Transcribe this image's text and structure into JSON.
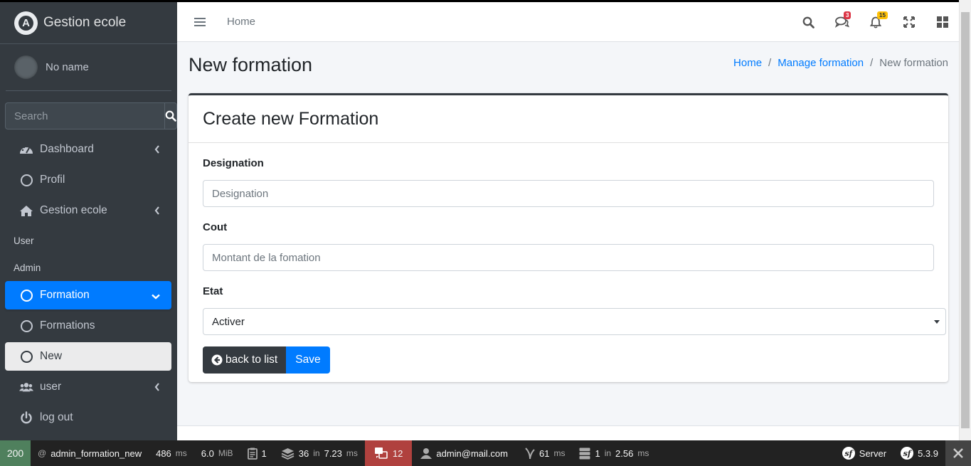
{
  "brand": {
    "name": "Gestion ecole"
  },
  "user": {
    "name": "No name"
  },
  "sidebar": {
    "search_placeholder": "Search",
    "items": [
      {
        "label": "Dashboard"
      },
      {
        "label": "Profil"
      },
      {
        "label": "Gestion ecole"
      }
    ],
    "headers": {
      "user": "User",
      "admin": "Admin"
    },
    "formation": {
      "label": "Formation",
      "children": [
        {
          "label": "Formations"
        },
        {
          "label": "New"
        }
      ]
    },
    "user_item": {
      "label": "user"
    },
    "logout": {
      "label": "log out"
    }
  },
  "header": {
    "home": "Home",
    "badges": {
      "messages": "3",
      "notifications": "15"
    }
  },
  "page": {
    "title": "New formation",
    "breadcrumb": [
      "Home",
      "Manage formation",
      "New formation"
    ]
  },
  "card": {
    "title": "Create new Formation",
    "fields": {
      "designation": {
        "label": "Designation",
        "placeholder": "Designation"
      },
      "cout": {
        "label": "Cout",
        "placeholder": "Montant de la fomation"
      },
      "etat": {
        "label": "Etat",
        "value": "Activer"
      }
    },
    "buttons": {
      "back": "back to list",
      "save": "Save"
    }
  },
  "sfbar": {
    "status": "200",
    "route": "admin_formation_new",
    "time_value": "486",
    "time_unit": "ms",
    "memory_value": "6.0",
    "memory_unit": "MiB",
    "forms": "1",
    "db_queries": "36",
    "db_in": "in",
    "db_time": "7.23",
    "db_unit": "ms",
    "translations": "12",
    "user": "admin@mail.com",
    "twig_time": "61",
    "twig_unit": "ms",
    "cache_calls": "1",
    "cache_in": "in",
    "cache_time": "2.56",
    "cache_unit": "ms",
    "server": "Server",
    "version": "5.3.9"
  }
}
